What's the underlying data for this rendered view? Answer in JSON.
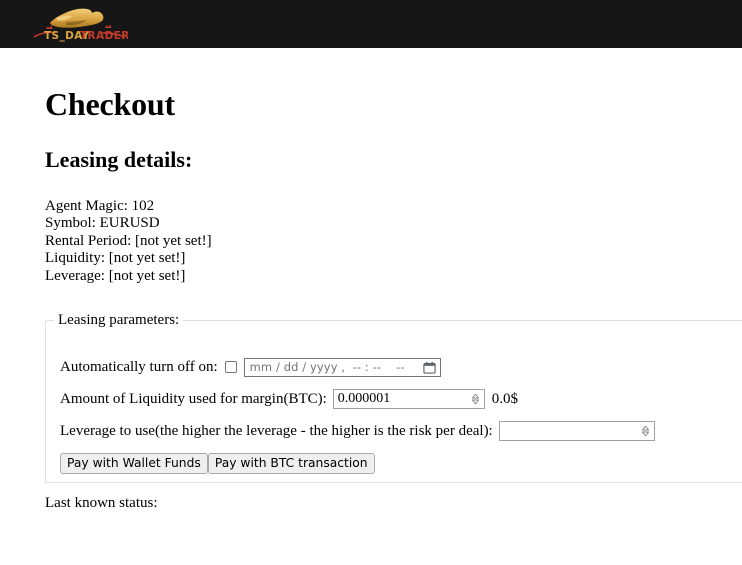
{
  "header": {
    "logo": {
      "icon": "bull-logo-icon",
      "text_primary": "TS_DAY",
      "text_secondary": "TRADER",
      "full_text": "TS_DAYTRADER",
      "color_gold": "#d9a441",
      "color_red": "#c0392b",
      "background": "#161616"
    }
  },
  "main": {
    "page_title": "Checkout",
    "section_title": "Leasing details:",
    "details": [
      "Agent Magic: 102",
      "Symbol: EURUSD",
      "Rental Period: [not yet set!]",
      "Liquidity: [not yet set!]",
      "Leverage: [not yet set!]"
    ],
    "fieldset": {
      "legend": "Leasing parameters:",
      "rows": {
        "auto_off": {
          "label": "Automatically turn off on:",
          "checkbox_checked": "false",
          "datetime_placeholder": "mm / dd / yyyy ,  -- : --    --",
          "calendar_icon": "calendar-icon"
        },
        "liquidity": {
          "label": "Amount of Liquidity used for margin(BTC):",
          "value": "0.000001",
          "suffix": "0.0$",
          "spinner_icon": "spinner-updown-icon"
        },
        "leverage": {
          "label": "Leverage to use(the higher the leverage - the higher is the risk per deal):",
          "value": "",
          "spinner_icon": "spinner-updown-icon"
        }
      },
      "buttons": [
        {
          "label": "Pay with Wallet Funds"
        },
        {
          "label": "Pay with BTC transaction"
        }
      ]
    },
    "status_label": "Last known status:"
  }
}
